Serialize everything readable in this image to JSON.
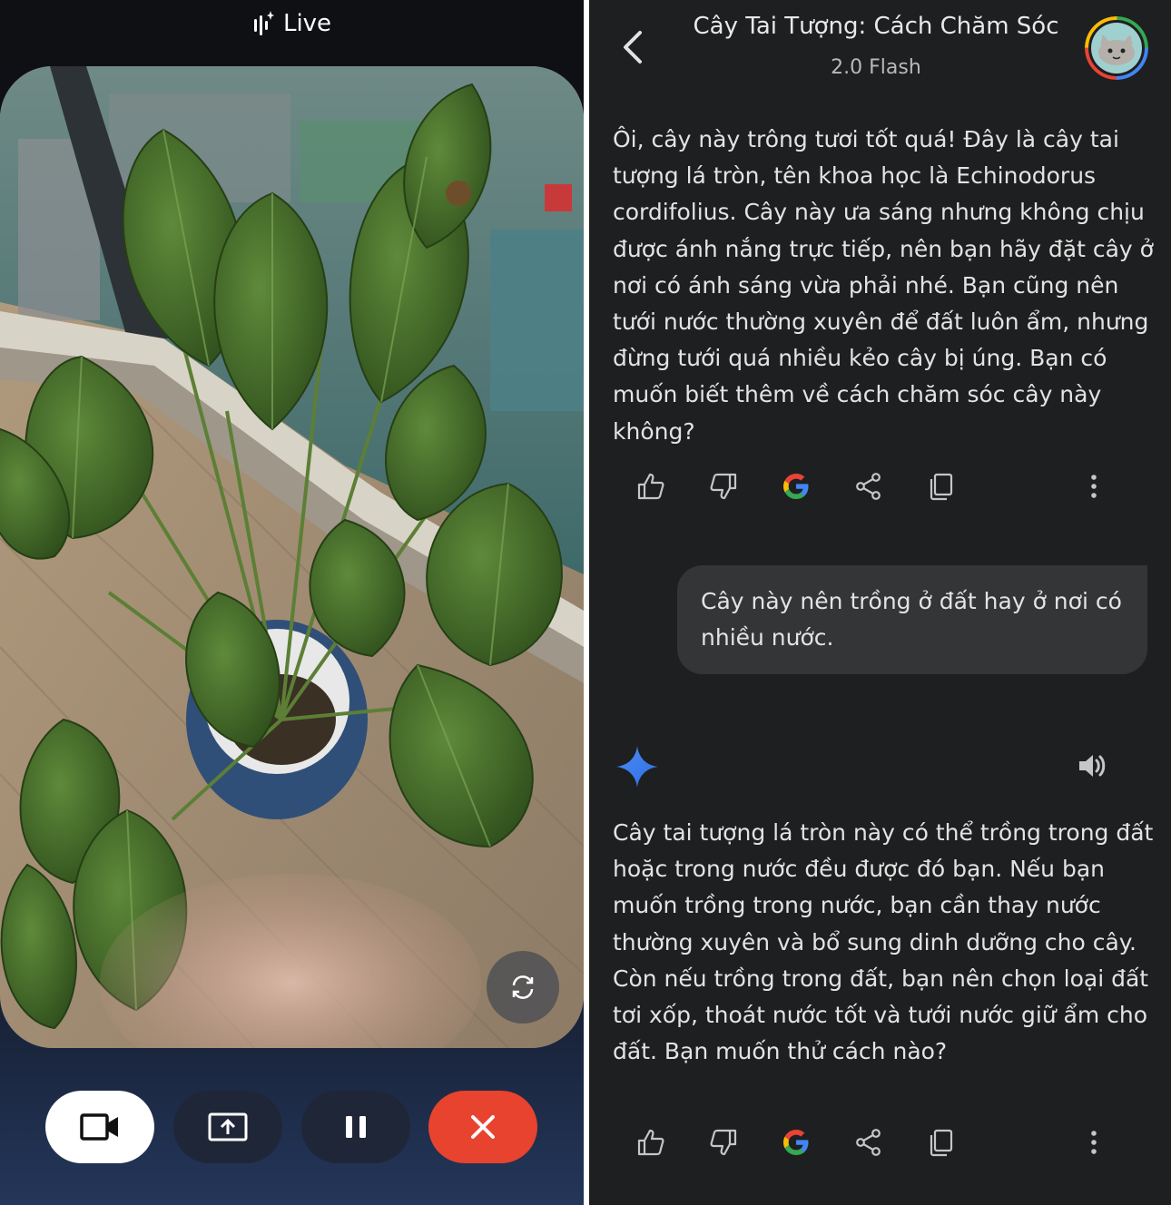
{
  "live": {
    "header_label": "Live",
    "controls": [
      {
        "name": "video-toggle-button",
        "icon": "video-camera-icon"
      },
      {
        "name": "share-screen-button",
        "icon": "screen-share-icon"
      },
      {
        "name": "pause-button",
        "icon": "pause-icon"
      },
      {
        "name": "end-call-button",
        "icon": "close-icon"
      }
    ],
    "flip_camera_icon": "camera-flip-icon"
  },
  "chat": {
    "title": "Cây Tai Tượng: Cách Chăm Sóc",
    "model": "2.0 Flash",
    "response_1": "Ôi, cây này trông tươi tốt quá! Đây là cây tai tượng lá tròn, tên khoa học là Echinodorus cordifolius. Cây này ưa sáng nhưng không chịu được ánh nắng trực tiếp, nên bạn hãy đặt cây ở nơi có ánh sáng vừa phải nhé. Bạn cũng nên tưới nước thường xuyên để đất luôn ẩm, nhưng đừng tưới quá nhiều kẻo cây bị úng. Bạn có muốn biết thêm về cách chăm sóc cây này không?",
    "user_message": "Cây này nên trồng ở đất hay ở nơi có nhiều nước.",
    "response_2": "Cây tai tượng lá tròn này có thể trồng trong đất hoặc trong nước đều được đó bạn. Nếu bạn muốn trồng trong nước, bạn cần thay nước thường xuyên và bổ sung dinh dưỡng cho cây. Còn nếu trồng trong đất, bạn nên chọn loại đất tơi xốp, thoát nước tốt và tưới nước giữ ẩm cho đất. Bạn muốn thử cách nào?",
    "actions": [
      "thumbs-up-icon",
      "thumbs-down-icon",
      "google-g-icon",
      "share-icon",
      "copy-icon",
      "more-vertical-icon"
    ]
  },
  "colors": {
    "end_call": "#e8432f",
    "chat_bg": "#1e1f20",
    "user_bubble": "#333537",
    "gemini_blue": "#4a8cf7"
  }
}
